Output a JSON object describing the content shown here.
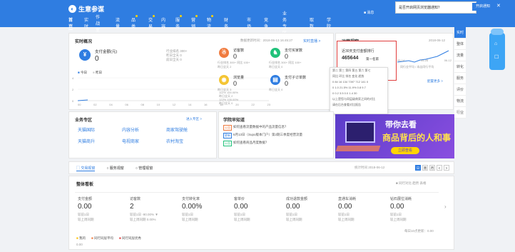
{
  "header": {
    "app_name": "生意参谋",
    "shop": "▼",
    "nav": [
      "首页",
      "实时",
      "作战室",
      "流量",
      "品类",
      "交易",
      "内容",
      "服务",
      "营销",
      "物流",
      "财务",
      "市场",
      "竞争",
      "业务专区",
      "取数",
      "学院"
    ],
    "nav_dots": [
      4,
      5,
      7,
      8,
      9
    ],
    "msg": "■ 消息",
    "notice": "是否开启网页浏览器通知？",
    "notice_btn": "开启通知",
    "close": "✕"
  },
  "realtime": {
    "title": "实时概况",
    "updated": "数据更新时间：2018-06-13 16:45:27",
    "live": "实时直播 >",
    "pay_label": "支付金额(元)",
    "pay_value": "0",
    "stats1": [
      "行业排名  300+",
      "昨日全天  0",
      "前日全天  0"
    ],
    "legend": [
      "今日",
      "昨日"
    ],
    "axis": [
      "00",
      "02",
      "04",
      "06",
      "08",
      "10",
      "12",
      "14",
      "16",
      "18",
      "20",
      "22",
      "23"
    ],
    "yticks": [
      "4",
      "2",
      "0"
    ],
    "kpis": [
      {
        "label": "访客数",
        "value": "0",
        "sub": "行业排名 300+  同比 100+",
        "sub2": "昨日全天  2",
        "color": "#f07b3f",
        "icon": "☃"
      },
      {
        "label": "支付买家数",
        "value": "0",
        "sub": "行业排名 300+  同比 100+",
        "sub2": "昨日全天  0",
        "color": "#20c27a",
        "icon": "♞"
      },
      {
        "label": "浏览量",
        "value": "0",
        "sub": "昨日全天  3",
        "sub2": "",
        "color": "#f4c534",
        "icon": "◉"
      },
      {
        "label": "支付子订单数",
        "value": "0",
        "sub": "昨日全天  0",
        "sub2": "",
        "color": "#2f7de1",
        "icon": "▤"
      }
    ],
    "kpi_side": [
      "112%  100.00%",
      "昨日全天  2",
      "122%  100.00%",
      "昨日全天  0"
    ]
  },
  "trend": {
    "title": "运营视窗",
    "date": "2018-06-12",
    "popup_title": "近30天支付金额排行",
    "popup_value": "465644",
    "popup_sub": "第一名第",
    "dd_lines": [
      "第二 第三 第四 第五 第六 第七",
      "同比 环比 排名 变化 趋势",
      "0  84  16  134  7397  712  141  0",
      "0  1.0  21.5%  11.9%  0.8  9.7",
      "0  0.2  3.5  0.0  1.4  30",
      "以上是您与同层级商家之间的对比",
      "请在后台查看对比报告"
    ],
    "axis": [
      "05-14",
      "05-28",
      "06-12"
    ],
    "link": "配置更多 >",
    "note": "同行业平均 / 本店同行平均"
  },
  "sidebar": [
    "实时",
    "整体",
    "流量",
    "转化",
    "服务",
    "评价",
    "物流",
    "行业"
  ],
  "float": [
    "⌂",
    "☐"
  ],
  "business": {
    "title": "业务专区",
    "more": "进入专区 >",
    "items": [
      "天猫国际",
      "内容分析",
      "商家驾驶舱",
      "天猫商升",
      "电视商家",
      "农村淘宝"
    ]
  },
  "learn": {
    "title": "学院早知道",
    "items": [
      {
        "tag": "公告",
        "text": "如何查看流量数据中的产品流量信息？"
      },
      {
        "tag": "更新",
        "text": "6月13日（Supo版本门户）第2期三季度经营流量"
      },
      {
        "tag": "公告",
        "text": "如何查看商品月度数据？"
      }
    ]
  },
  "banner": {
    "t1": "带你去看",
    "t2": "商品背后的人和事",
    "btn": "立即查看"
  },
  "tabs": {
    "items": [
      "交易视窗",
      "服务视窗",
      "管理视窗"
    ],
    "date_label": "统计时间 2018-06-12",
    "pager": [
      "日",
      "周",
      "月",
      "<",
      ">"
    ]
  },
  "overview": {
    "title": "整体看板",
    "right": "■ 同行对比  趋势  表格",
    "metrics": [
      {
        "label": "支付金额",
        "value": "0.00",
        "s1": "较前1日",
        "s2": "较上周同期"
      },
      {
        "label": "访客数",
        "value": "2",
        "s1": "较前1日  -90.00% ▼",
        "s2": "较上周同期  0.00%"
      },
      {
        "label": "支付转化率",
        "value": "0.00%",
        "s1": "较前1日",
        "s2": "较上周同期"
      },
      {
        "label": "客单价",
        "value": "0.00",
        "s1": "较前1日",
        "s2": "较上周同期"
      },
      {
        "label": "成功退款金额",
        "value": "0.00",
        "s1": "较前1日",
        "s2": "较上周同期"
      },
      {
        "label": "直通车消耗",
        "value": "0.00",
        "s1": "较前1日",
        "s2": "较上周同期"
      },
      {
        "label": "钻石展位消耗",
        "value": "0.00",
        "s1": "较前1日",
        "s2": "较上周同期"
      }
    ],
    "foot_right": "每日10点更新：0.00",
    "legend": [
      "我的",
      "同行同层平均",
      "同行同层优秀"
    ],
    "foot_val": "0.00"
  }
}
